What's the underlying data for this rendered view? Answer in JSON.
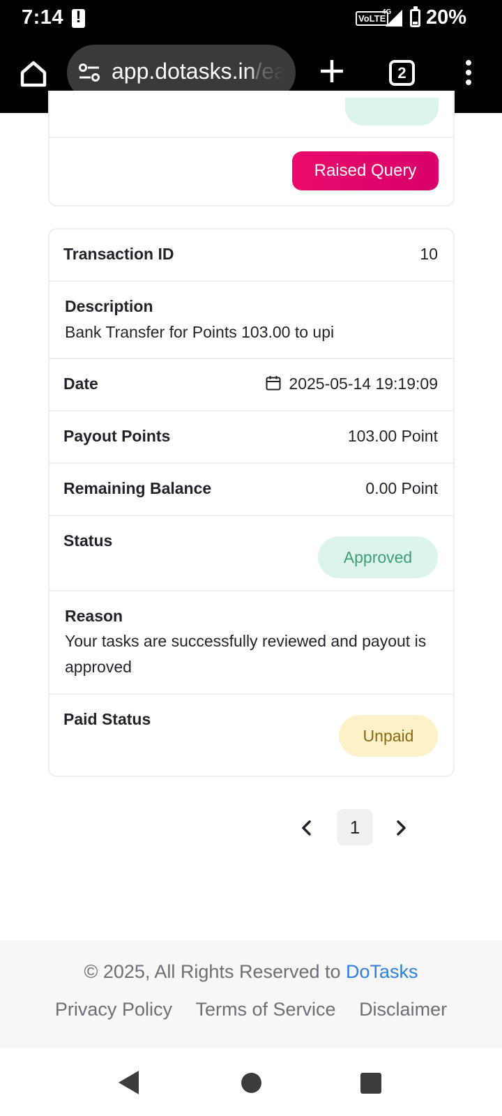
{
  "status_bar": {
    "time": "7:14",
    "network_label": "VoLTE",
    "network_type": "4G",
    "battery": "20%"
  },
  "browser": {
    "url_host": "app.dotasks.in",
    "url_path": "/ea",
    "tab_count": "2"
  },
  "prev_card": {
    "button_label": "Raised Query"
  },
  "transaction": {
    "id_label": "Transaction ID",
    "id_value": "10",
    "description_label": "Description",
    "description_value": "Bank Transfer for Points 103.00 to upi",
    "date_label": "Date",
    "date_value": "2025-05-14 19:19:09",
    "payout_label": "Payout Points",
    "payout_value": "103.00 Point",
    "balance_label": "Remaining Balance",
    "balance_value": "0.00 Point",
    "status_label": "Status",
    "status_value": "Approved",
    "reason_label": "Reason",
    "reason_value": "Your tasks are successfully reviewed and payout is approved",
    "paid_status_label": "Paid Status",
    "paid_status_value": "Unpaid"
  },
  "pagination": {
    "current_page": "1"
  },
  "footer": {
    "copyright_prefix": "© 2025, All Rights Reserved to ",
    "brand": "DoTasks",
    "privacy": "Privacy Policy",
    "terms": "Terms of Service",
    "disclaimer": "Disclaimer"
  },
  "colors": {
    "accent_pink": "#e2086c",
    "approved_bg": "#dcf5ea",
    "approved_text": "#3f9c77",
    "unpaid_bg": "#fdf1c9",
    "link_blue": "#2f7fe0"
  }
}
